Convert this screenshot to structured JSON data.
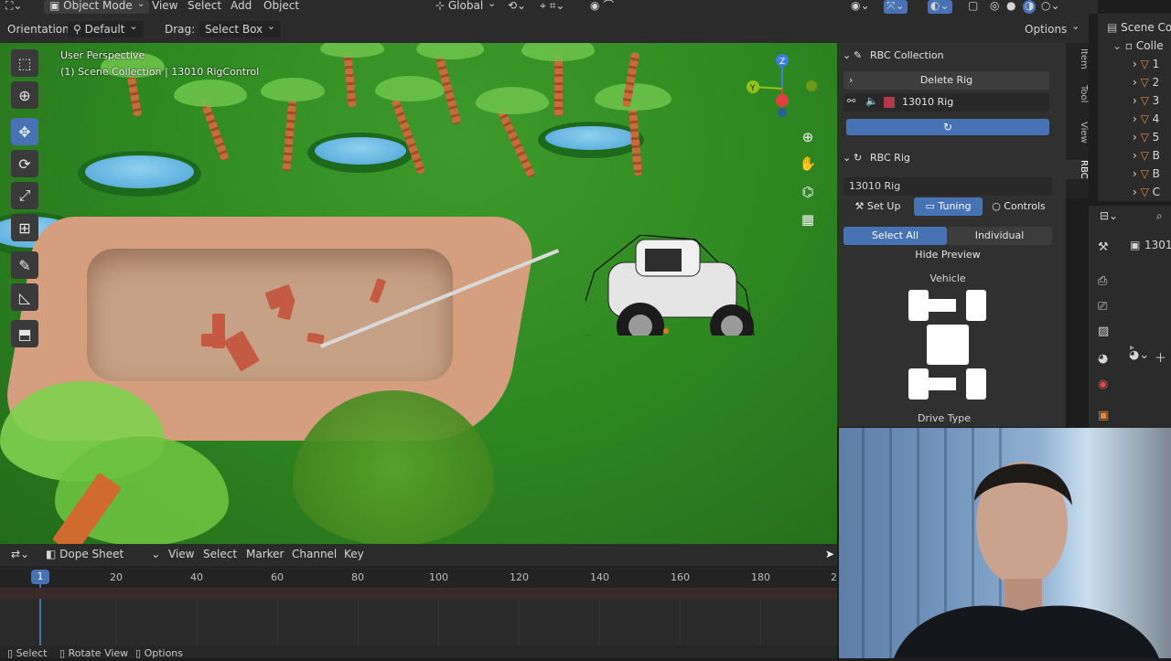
{
  "header": {
    "mode": "Object Mode",
    "menus": [
      "View",
      "Select",
      "Add",
      "Object"
    ],
    "transform_orientation": "Global"
  },
  "tool_settings": {
    "orientation_label": "Orientation:",
    "orientation_value": "Default",
    "drag_label": "Drag:",
    "drag_value": "Select Box",
    "options": "Options"
  },
  "viewport": {
    "view_name": "User Perspective",
    "collection_info": "(1) Scene Collection | 13010 RigControl"
  },
  "npanel": {
    "collection_title": "RBC Collection",
    "delete_rig": "Delete Rig",
    "rig_name_field": "13010 Rig",
    "rig_title": "RBC Rig",
    "rig_name": "13010 Rig",
    "tabs": [
      "Set Up",
      "Tuning",
      "Controls"
    ],
    "active_tab": "Tuning",
    "select_all": "Select All",
    "individual": "Individual",
    "hide_preview": "Hide Preview",
    "vehicle": "Vehicle",
    "drive_type": "Drive Type",
    "side_tabs": [
      "Item",
      "Tool",
      "View",
      "RBC"
    ]
  },
  "outliner": {
    "title": "Scene Co",
    "collection": "Colle",
    "rows": [
      "1",
      "2",
      "3",
      "4",
      "5",
      "B",
      "B",
      "C"
    ]
  },
  "properties": {
    "value": "1301"
  },
  "timeline": {
    "editor": "Dope Sheet",
    "menus": [
      "View",
      "Select",
      "Marker",
      "Channel",
      "Key"
    ],
    "current_frame": "1",
    "ticks": [
      "20",
      "40",
      "60",
      "80",
      "100",
      "120",
      "140",
      "160",
      "180",
      "2"
    ]
  },
  "statusbar": {
    "items": [
      "Select",
      "Rotate View",
      "Options"
    ]
  }
}
